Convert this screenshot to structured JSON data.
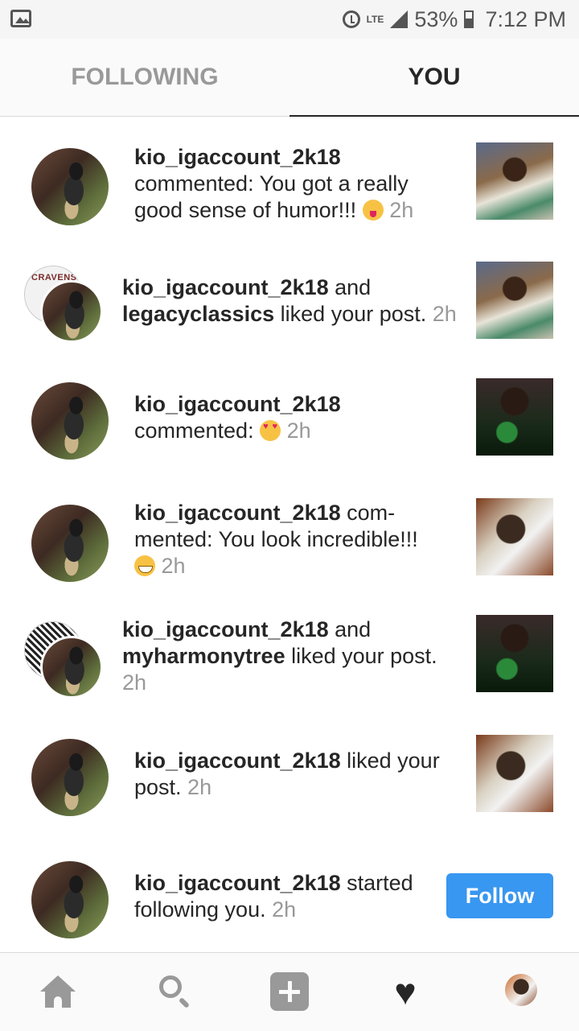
{
  "status_bar": {
    "network": "LTE",
    "battery": "53%",
    "time": "7:12 PM"
  },
  "tabs": [
    {
      "label": "FOLLOWING",
      "active": false
    },
    {
      "label": "YOU",
      "active": true
    }
  ],
  "feed": [
    {
      "user": "kio_igaccount_2k18",
      "text": " commented: You got a really good sense of humor!!! ",
      "emoji": "face-with-tongue",
      "time": "2h"
    },
    {
      "user": "kio_igaccount_2k18",
      "joiner": " and ",
      "user2": "legacyclassics",
      "text": " liked your post. ",
      "time": "2h",
      "secondary_avatar_text": "CRAVENS"
    },
    {
      "user": "kio_igaccount_2k18",
      "text": " commented: ",
      "emoji": "heart-eyes",
      "time": "2h"
    },
    {
      "user": "kio_igaccount_2k18",
      "text": " com-mented: You look incredible!!! ",
      "emoji": "grinning-face",
      "time": "2h"
    },
    {
      "user": "kio_igaccount_2k18",
      "joiner": " and ",
      "user2": "myharmonytree",
      "text": " liked your post. ",
      "time": "2h"
    },
    {
      "user": "kio_igaccount_2k18",
      "text": " liked your post. ",
      "time": "2h"
    },
    {
      "user": "kio_igaccount_2k18",
      "text": " started following you. ",
      "time": "2h",
      "action": "Follow"
    }
  ],
  "colors": {
    "follow_button": "#3897f0",
    "secondary_text": "#999999",
    "primary_text": "#262626"
  },
  "bottom_nav": [
    "home-icon",
    "search-icon",
    "add-icon",
    "heart-icon",
    "profile-icon"
  ]
}
